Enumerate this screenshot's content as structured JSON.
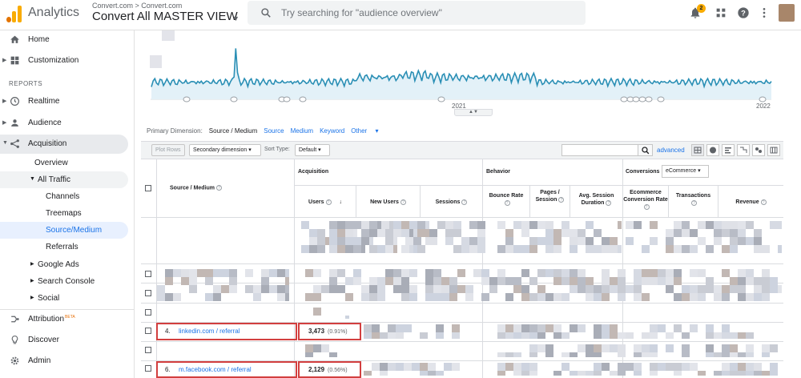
{
  "app": {
    "name": "Analytics",
    "breadcrumb": "Convert.com > Convert.com",
    "view_title": "Convert All MASTER VIEW",
    "search_placeholder": "Try searching for \"audience overview\"",
    "notification_count": "2",
    "icons": [
      "analytics-logo-icon",
      "search-icon",
      "bell-icon",
      "apps-grid-icon",
      "help-icon",
      "more-vert-icon"
    ]
  },
  "sidebar": {
    "top_items": [
      {
        "label": "Home",
        "icon": "home-icon"
      },
      {
        "label": "Customization",
        "icon": "grid-icon"
      }
    ],
    "reports_heading": "REPORTS",
    "report_items": [
      {
        "label": "Realtime",
        "icon": "clock-icon"
      },
      {
        "label": "Audience",
        "icon": "person-icon"
      },
      {
        "label": "Acquisition",
        "icon": "acquisition-icon"
      }
    ],
    "acquisition_children": [
      "Overview",
      "All Traffic",
      "Google Ads",
      "Search Console",
      "Social"
    ],
    "all_traffic_children": [
      "Channels",
      "Treemaps",
      "Source/Medium",
      "Referrals"
    ],
    "bottom_items": [
      {
        "label": "Attribution",
        "badge": "BETA",
        "icon": "attribution-icon"
      },
      {
        "label": "Discover",
        "icon": "lightbulb-icon"
      },
      {
        "label": "Admin",
        "icon": "gear-icon"
      }
    ]
  },
  "chart": {
    "x_labels": [
      "2021",
      "2022"
    ],
    "color": "#2a8fb5"
  },
  "dimension_bar": {
    "label": "Primary Dimension:",
    "current": "Source / Medium",
    "options": [
      "Source",
      "Medium",
      "Keyword",
      "Other"
    ]
  },
  "controls": {
    "plot_rows": "Plot Rows",
    "secondary_dimension": "Secondary dimension",
    "sort_type_label": "Sort Type:",
    "sort_type_value": "Default",
    "advanced": "advanced"
  },
  "table": {
    "dimension_header": "Source / Medium",
    "groups": {
      "acquisition": "Acquisition",
      "behavior": "Behavior",
      "conversions": "Conversions",
      "conversions_select": "eCommerce"
    },
    "columns": {
      "users": "Users",
      "new_users": "New Users",
      "sessions": "Sessions",
      "bounce_rate": "Bounce Rate",
      "pages_session": "Pages / Session",
      "avg_session": "Avg. Session Duration",
      "ecommerce_rate": "Ecommerce Conversion Rate",
      "transactions": "Transactions",
      "revenue": "Revenue"
    },
    "visible_rows": [
      {
        "num": "4.",
        "source": "linkedin.com / referral",
        "users": "3,473",
        "users_pct": "(0.91%)"
      },
      {
        "num": "6.",
        "source": "m.facebook.com / referral",
        "users": "2,129",
        "users_pct": "(0.56%)"
      }
    ]
  },
  "colors": {
    "accent": "#1a73e8",
    "highlight_border": "#d23f3f",
    "chart_line": "#2a8fb5"
  }
}
